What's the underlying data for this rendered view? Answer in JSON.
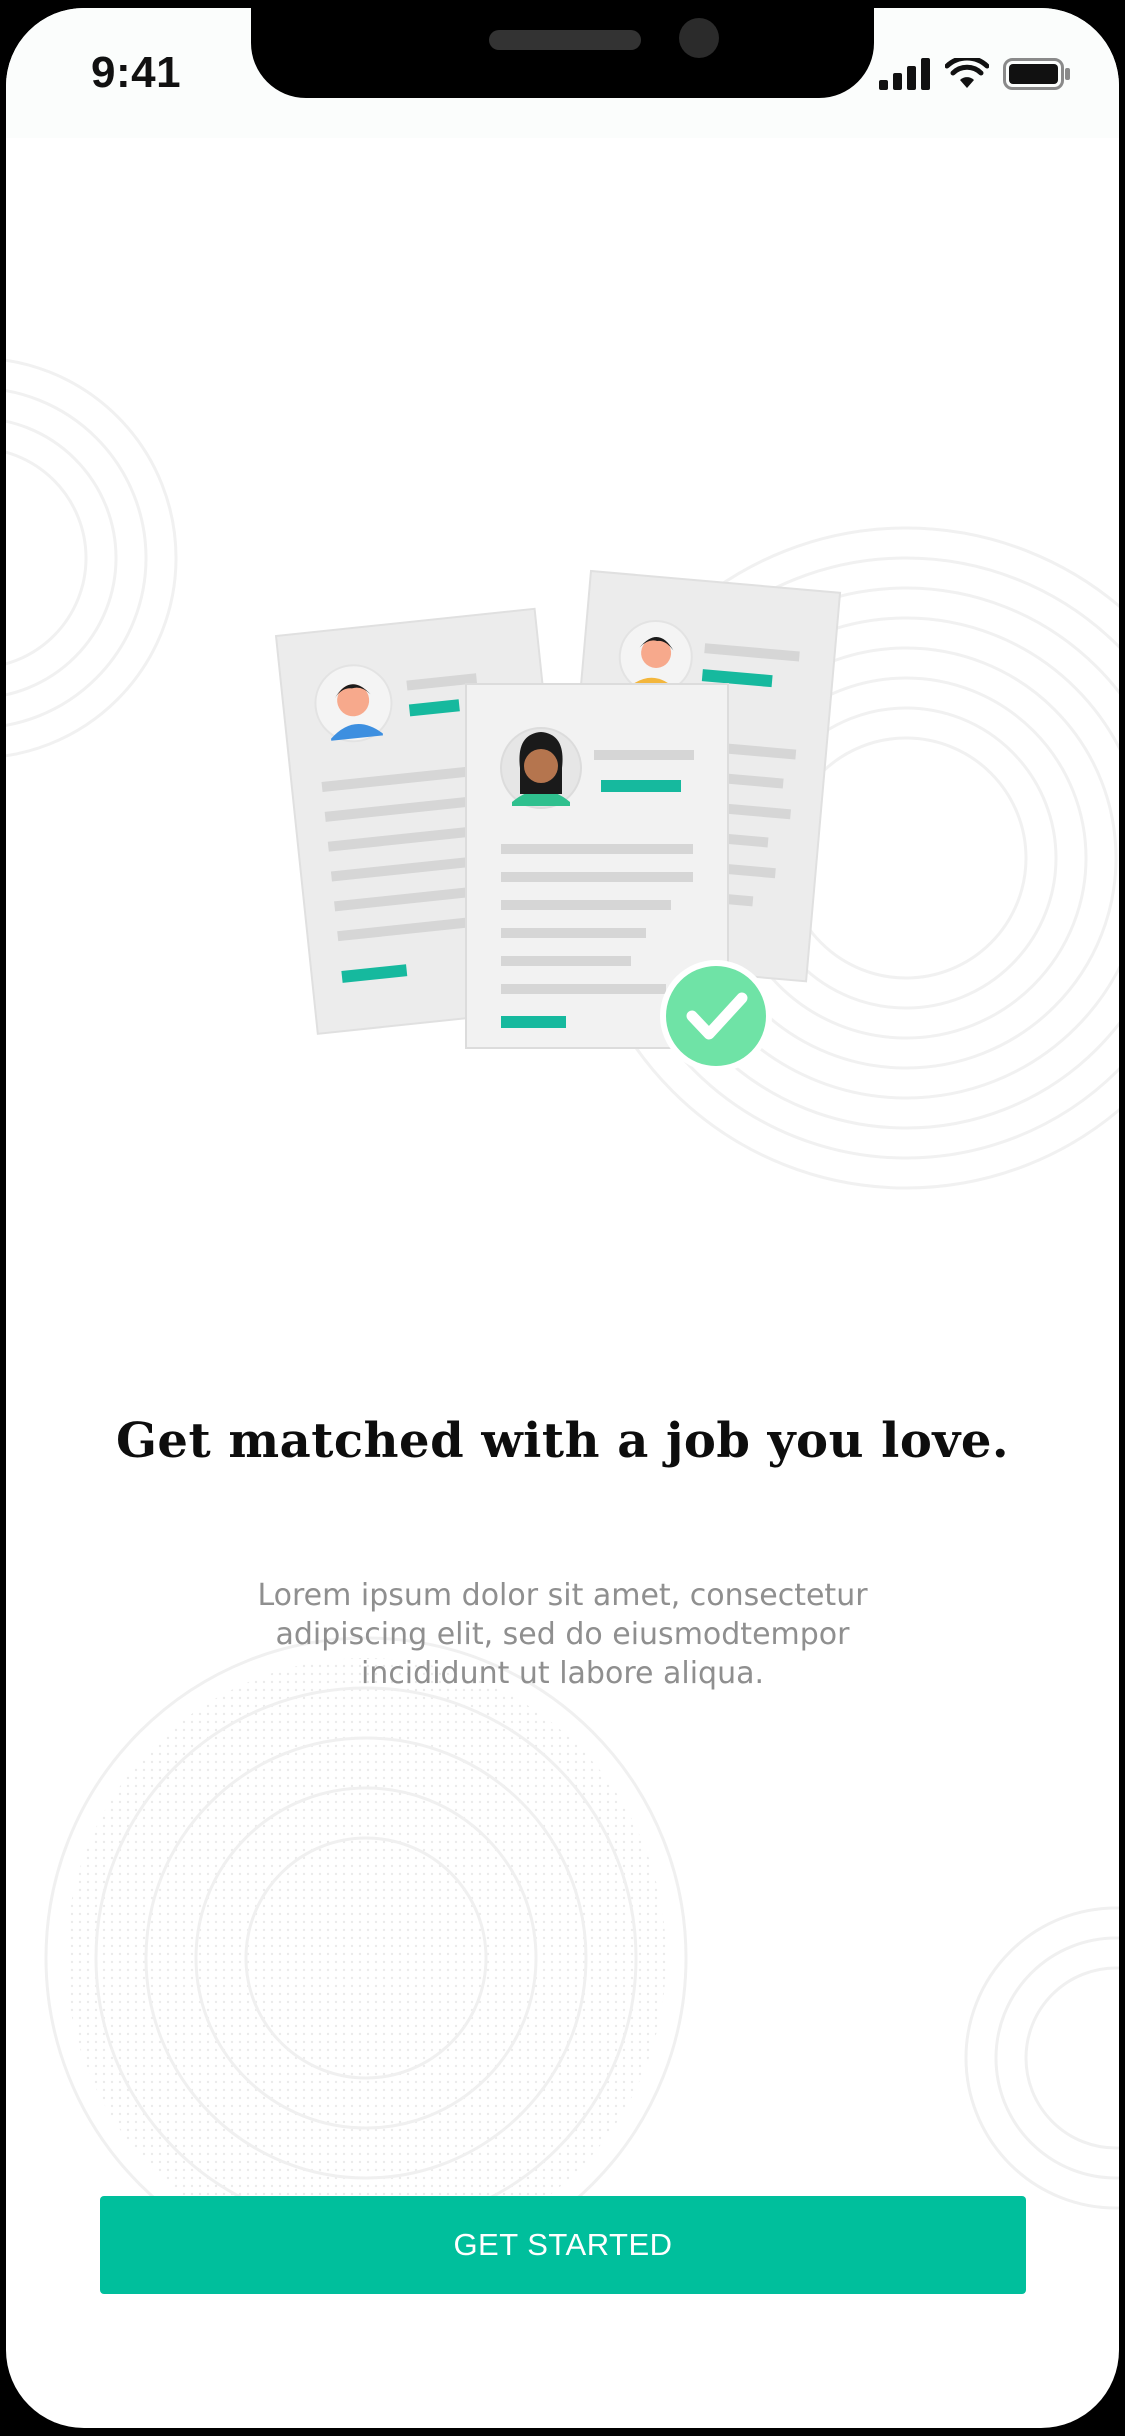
{
  "status_bar": {
    "time": "9:41",
    "icons": [
      "cellular-signal-icon",
      "wifi-icon",
      "battery-icon"
    ]
  },
  "onboarding": {
    "illustration": "resume-documents-checkmark-illustration",
    "headline": "Get matched with a job you love.",
    "body": "Lorem ipsum dolor sit amet, consectetur adipiscing elit, sed do eiusmodtempor incididunt ut labore aliqua.",
    "cta_label": "GET STARTED"
  },
  "colors": {
    "accent": "#00BF9C",
    "check_badge": "#6FE3A6",
    "headline": "#0D0D0D",
    "body_text": "#8F8F8F",
    "document": "#F0F0F0"
  }
}
